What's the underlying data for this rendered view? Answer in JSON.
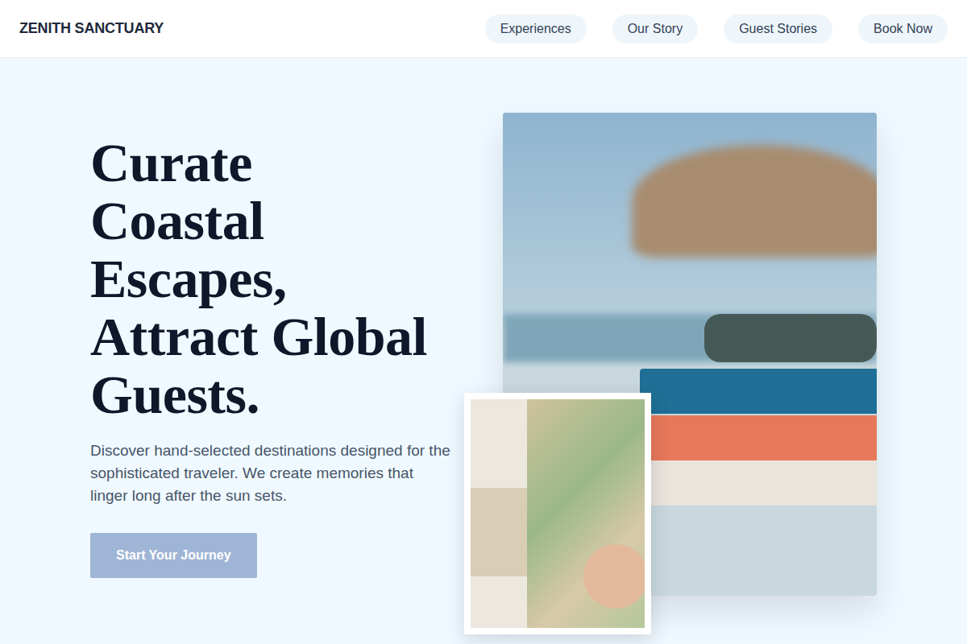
{
  "header": {
    "brand": "ZENITH SANCTUARY",
    "nav": [
      {
        "label": "Experiences",
        "selected": false
      },
      {
        "label": "Our Story",
        "selected": false
      },
      {
        "label": "Guest Stories",
        "selected": false
      },
      {
        "label": "Book Now",
        "selected": false
      }
    ]
  },
  "hero": {
    "headline": [
      "Curate",
      "Coastal",
      "Escapes,",
      "Attract Global",
      "Guests."
    ],
    "subtitle": "Discover hand-selected destinations designed for the sophisticated traveler. We create memories that linger long after the sun sets.",
    "cta": {
      "label": "Start Your Journey",
      "disabled": true
    }
  }
}
